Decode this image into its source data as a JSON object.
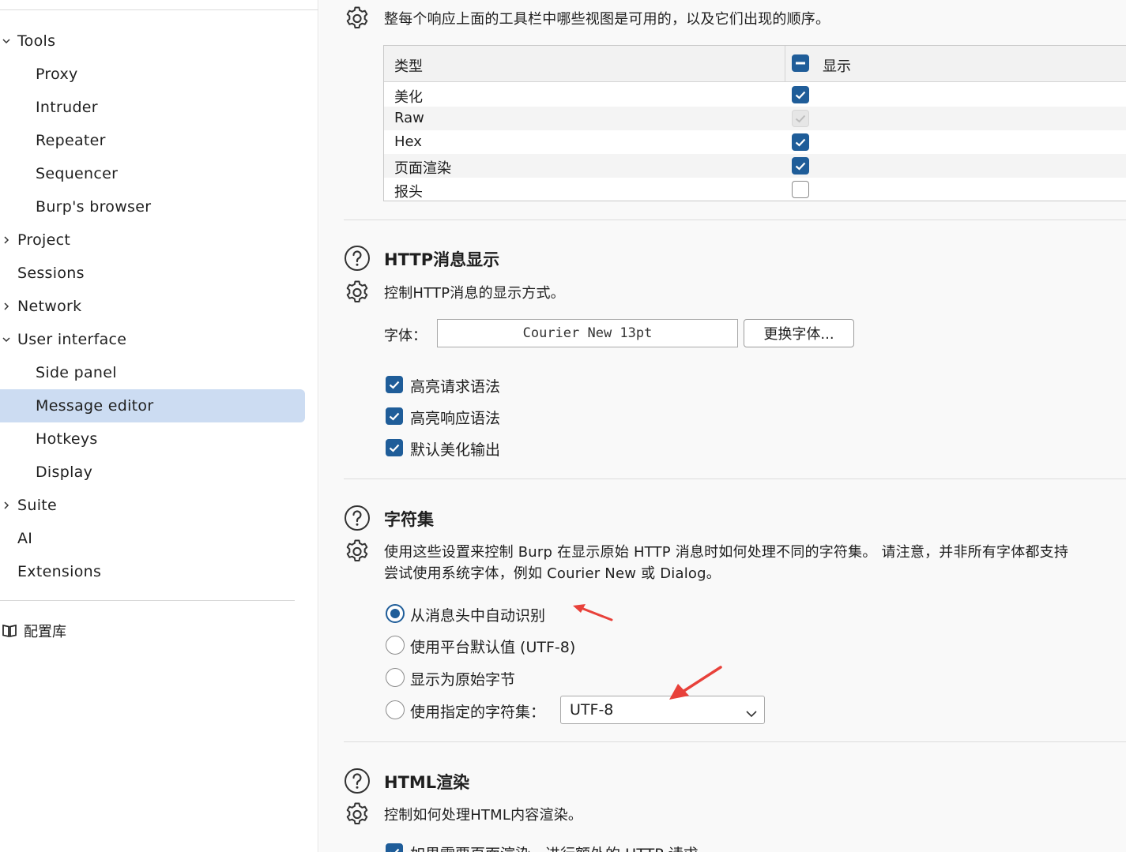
{
  "sidebar": {
    "items": [
      {
        "label": "Tools",
        "level": 0,
        "chevron": "expanded"
      },
      {
        "label": "Proxy",
        "level": 1
      },
      {
        "label": "Intruder",
        "level": 1
      },
      {
        "label": "Repeater",
        "level": 1
      },
      {
        "label": "Sequencer",
        "level": 1
      },
      {
        "label": "Burp's browser",
        "level": 1
      },
      {
        "label": "Project",
        "level": 0,
        "chevron": "collapsed"
      },
      {
        "label": "Sessions",
        "level": 0
      },
      {
        "label": "Network",
        "level": 0,
        "chevron": "collapsed"
      },
      {
        "label": "User interface",
        "level": 0,
        "chevron": "expanded"
      },
      {
        "label": "Side panel",
        "level": 1
      },
      {
        "label": "Message editor",
        "level": 1,
        "selected": true
      },
      {
        "label": "Hotkeys",
        "level": 1
      },
      {
        "label": "Display",
        "level": 1
      },
      {
        "label": "Suite",
        "level": 0,
        "chevron": "collapsed"
      },
      {
        "label": "AI",
        "level": 0
      },
      {
        "label": "Extensions",
        "level": 0
      }
    ],
    "library_label": "配置库"
  },
  "views_section": {
    "description": "整每个响应上面的工具栏中哪些视图是可用的，以及它们出现的顺序。",
    "table": {
      "headers": [
        "类型",
        "显示"
      ],
      "rows": [
        {
          "type": "美化",
          "state": "checked"
        },
        {
          "type": "Raw",
          "state": "disabled"
        },
        {
          "type": "Hex",
          "state": "checked"
        },
        {
          "type": "页面渲染",
          "state": "checked"
        },
        {
          "type": "报头",
          "state": "unchecked"
        }
      ]
    }
  },
  "http_section": {
    "title": "HTTP消息显示",
    "description": "控制HTTP消息的显示方式。",
    "font_label": "字体：",
    "font_value": "Courier New 13pt",
    "change_font_button": "更换字体...",
    "options": [
      {
        "label": "高亮请求语法",
        "checked": true
      },
      {
        "label": "高亮响应语法",
        "checked": true
      },
      {
        "label": "默认美化输出",
        "checked": true
      }
    ]
  },
  "charset_section": {
    "title": "字符集",
    "description_line1": "使用这些设置来控制 Burp 在显示原始 HTTP 消息时如何处理不同的字符集。 请注意，并非所有字体都支持",
    "description_line2": "尝试使用系统字体，例如 Courier New 或 Dialog。",
    "options": [
      {
        "label": "从消息头中自动识别",
        "selected": true
      },
      {
        "label": "使用平台默认值 (UTF-8)",
        "selected": false
      },
      {
        "label": "显示为原始字节",
        "selected": false
      },
      {
        "label": "使用指定的字符集：",
        "selected": false
      }
    ],
    "charset_value": "UTF-8"
  },
  "html_section": {
    "title": "HTML渲染",
    "description": "控制如何处理HTML内容渲染。",
    "partial_option": "如果需要页面渲染，进行额外的 HTTP 请求"
  },
  "colors": {
    "accent": "#1f5d99",
    "selection": "#ccdcf2",
    "annotation_arrow": "#e8413a"
  }
}
